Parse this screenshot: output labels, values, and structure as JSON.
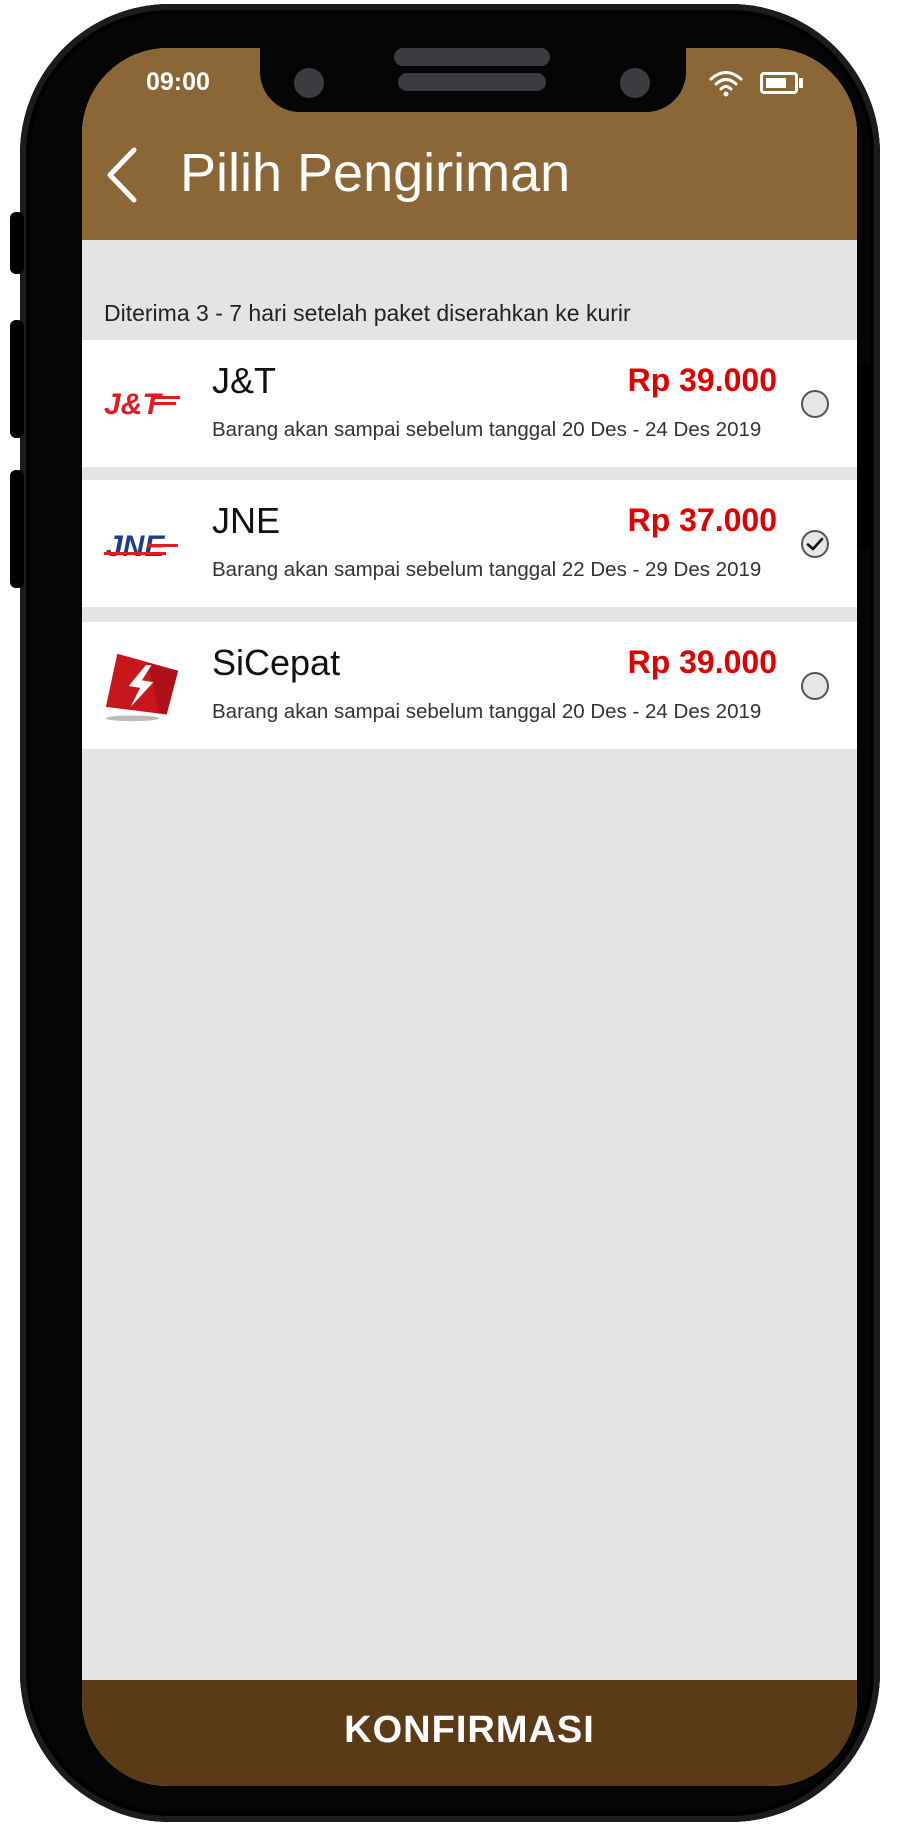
{
  "status": {
    "time": "09:00",
    "icons": [
      "wifi-icon",
      "battery-icon"
    ]
  },
  "header": {
    "title": "Pilih Pengiriman",
    "back_icon": "chevron-left-icon"
  },
  "subtitle": "Diterima 3 - 7 hari setelah paket diserahkan ke kurir",
  "couriers": [
    {
      "name": "J&T",
      "price": "Rp 39.000",
      "desc": "Barang akan sampai sebelum tanggal 20 Des - 24 Des 2019",
      "logo": "J&T",
      "selected": false
    },
    {
      "name": "JNE",
      "price": "Rp 37.000",
      "desc": "Barang akan sampai sebelum tanggal 22 Des - 29 Des 2019",
      "logo": "JNE",
      "selected": true
    },
    {
      "name": "SiCepat",
      "price": "Rp 39.000",
      "desc": "Barang akan sampai sebelum tanggal 20 Des - 24 Des 2019",
      "logo": "sicepat-logo",
      "selected": false
    }
  ],
  "footer": {
    "confirm_label": "KONFIRMASI"
  },
  "colors": {
    "header": "#8b6636",
    "footer": "#5b3a18",
    "price": "#e00000",
    "background": "#e4e4e4"
  }
}
